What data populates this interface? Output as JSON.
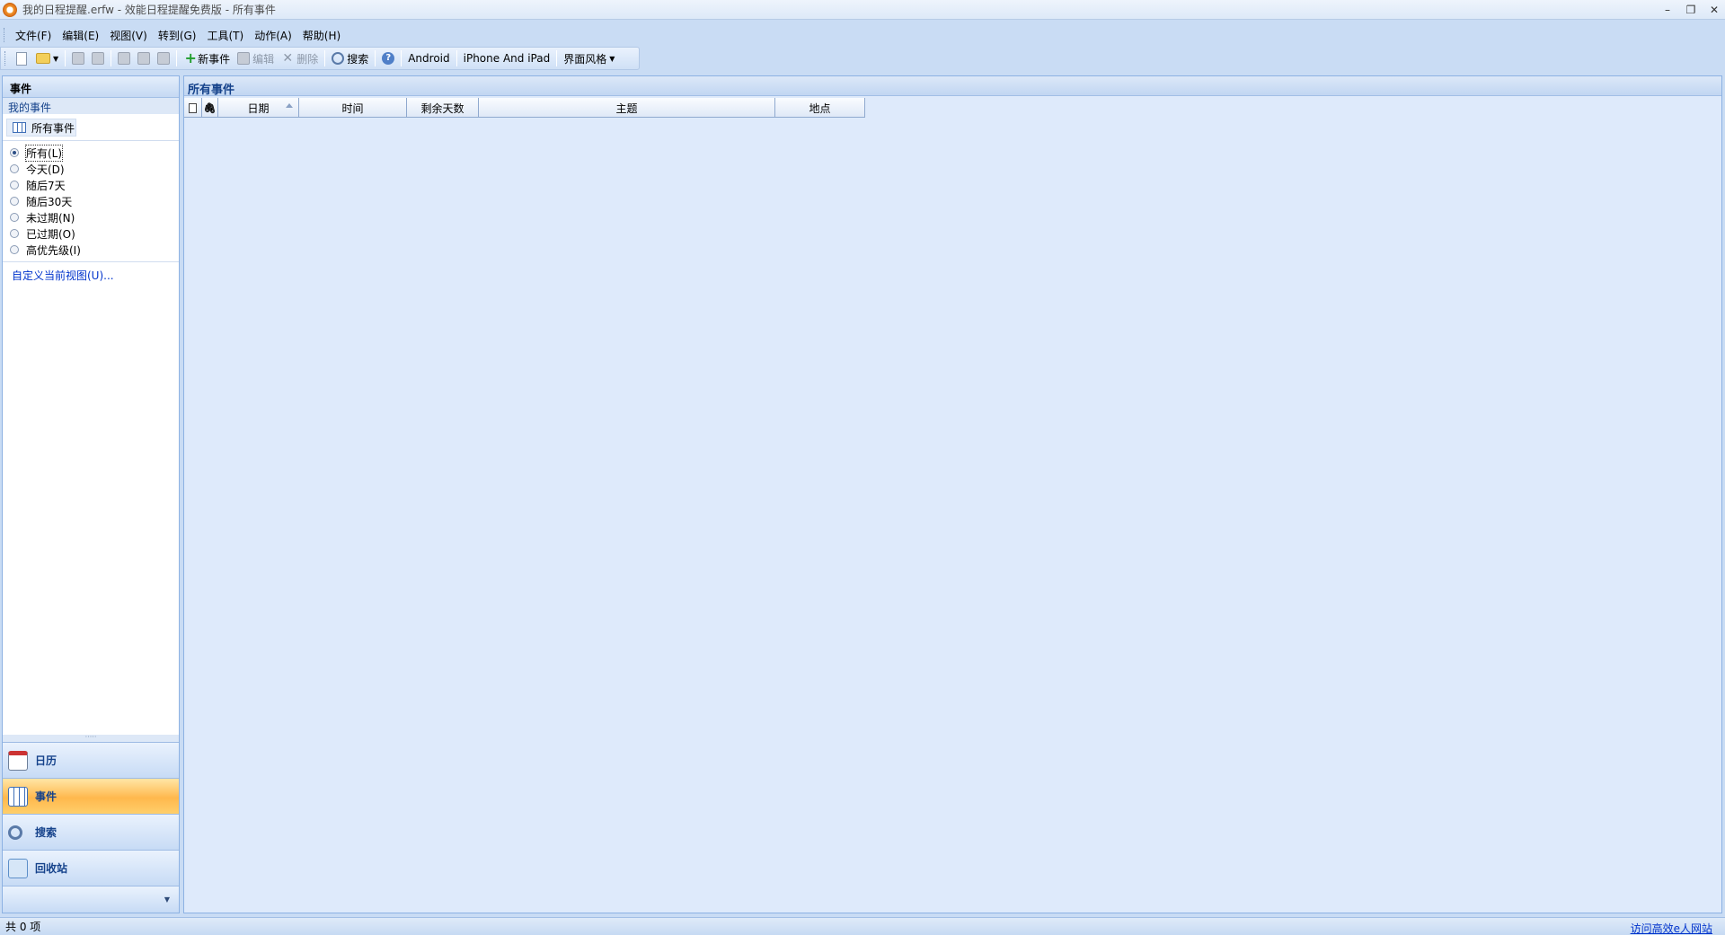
{
  "window": {
    "title": "我的日程提醒.erfw - 效能日程提醒免费版 - 所有事件"
  },
  "menu": [
    "文件(F)",
    "编辑(E)",
    "视图(V)",
    "转到(G)",
    "工具(T)",
    "动作(A)",
    "帮助(H)"
  ],
  "toolbar": {
    "new_event": "新事件",
    "edit": "编辑",
    "delete": "删除",
    "search": "搜索",
    "android": "Android",
    "iphone": "iPhone And iPad",
    "theme": "界面风格"
  },
  "left": {
    "header": "事件",
    "section": "我的事件",
    "view_item": "所有事件",
    "filters": [
      "所有(L)",
      "今天(D)",
      "随后7天",
      "随后30天",
      "未过期(N)",
      "已过期(O)",
      "高优先级(I)"
    ],
    "selected_filter": 0,
    "customize_link": "自定义当前视图(U)...",
    "nav": {
      "calendar": "日历",
      "events": "事件",
      "search": "搜索",
      "recycle": "回收站"
    }
  },
  "main": {
    "header": "所有事件",
    "columns": [
      "日期",
      "时间",
      "剩余天数",
      "主题",
      "地点"
    ],
    "rows": []
  },
  "status": {
    "count": "共 0 项",
    "link": "访问高效e人网站"
  }
}
